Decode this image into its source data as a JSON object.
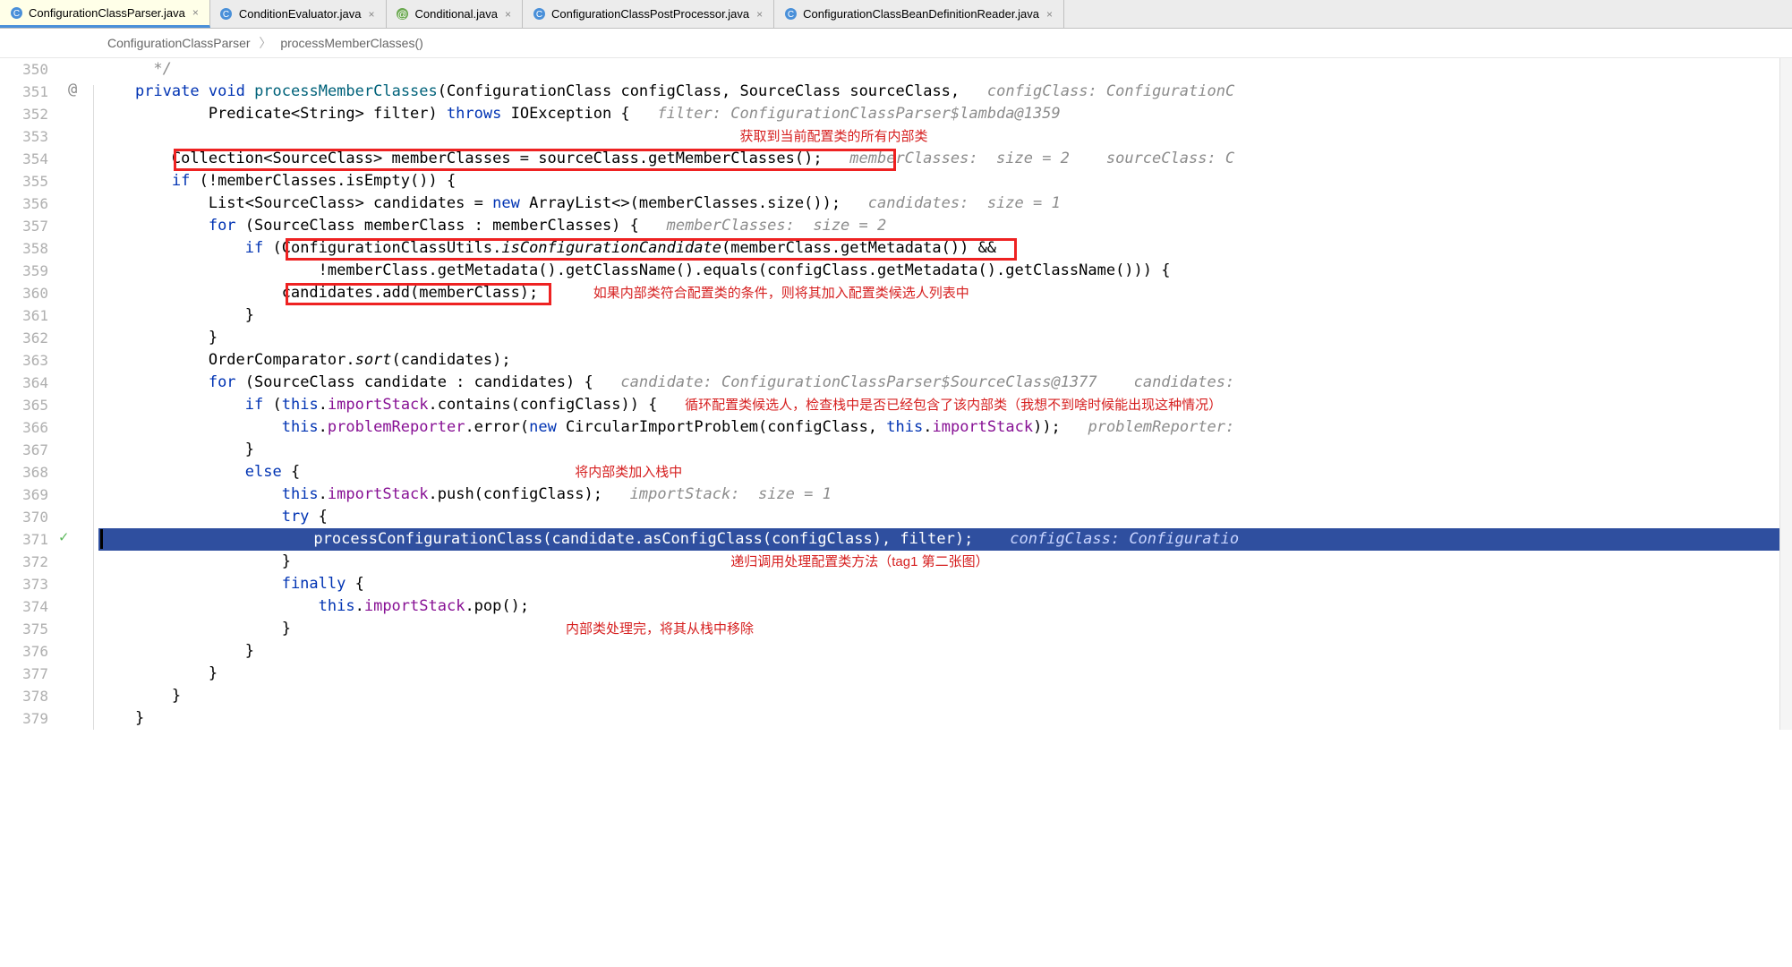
{
  "tabs": [
    {
      "label": "ConfigurationClassParser.java",
      "active": true,
      "iconColor": "blue"
    },
    {
      "label": "ConditionEvaluator.java",
      "active": false,
      "iconColor": "blue"
    },
    {
      "label": "Conditional.java",
      "active": false,
      "iconColor": "green"
    },
    {
      "label": "ConfigurationClassPostProcessor.java",
      "active": false,
      "iconColor": "blue"
    },
    {
      "label": "ConfigurationClassBeanDefinitionReader.java",
      "active": false,
      "iconColor": "blue"
    }
  ],
  "breadcrumb": {
    "class": "ConfigurationClassParser",
    "method": "processMemberClasses()"
  },
  "lineStart": 350,
  "lineEnd": 379,
  "gutterMarkers": {
    "at": 351,
    "check": 371
  },
  "annotations": {
    "a1": "获取到当前配置类的所有内部类",
    "a2": "如果内部类符合配置类的条件，则将其加入配置类候选人列表中",
    "a3": "循环配置类候选人，检查栈中是否已经包含了该内部类（我想不到啥时候能出现这种情况）",
    "a4": "将内部类加入栈中",
    "a5": "递归调用处理配置类方法（tag1 第二张图）",
    "a6": "内部类处理完，将其从栈中移除"
  },
  "hints": {
    "h351": "configClass: ConfigurationC",
    "h352": "filter: ConfigurationClassParser$lambda@1359",
    "h354a": "memberClasses:  size = 2",
    "h354b": "sourceClass: C",
    "h356": "candidates:  size = 1",
    "h357": "memberClasses:  size = 2",
    "h364a": "candidate: ConfigurationClassParser$SourceClass@1377",
    "h364b": "candidates:",
    "h366": "problemReporter:",
    "h369": "importStack:  size = 1",
    "h371": "configClass: Configuratio"
  },
  "code": {
    "l350": "*/",
    "l351_pre": "private void ",
    "l351_m": "processMemberClasses",
    "l351_post": "(ConfigurationClass configClass, SourceClass sourceClass,",
    "l352": "Predicate<String> filter) throws IOException {",
    "l354": "Collection<SourceClass> memberClasses = sourceClass.getMemberClasses();",
    "l355": "if (!memberClasses.isEmpty()) {",
    "l356": "List<SourceClass> candidates = new ArrayList<>(memberClasses.size());",
    "l357": "for (SourceClass memberClass : memberClasses) {",
    "l358": "if (ConfigurationClassUtils.isConfigurationCandidate(memberClass.getMetadata()) &&",
    "l359": "!memberClass.getMetadata().getClassName().equals(configClass.getMetadata().getClassName())) {",
    "l360": "candidates.add(memberClass);",
    "l363": "OrderComparator.sort(candidates);",
    "l364": "for (SourceClass candidate : candidates) {",
    "l365": "if (this.importStack.contains(configClass)) {",
    "l366": "this.problemReporter.error(new CircularImportProblem(configClass, this.importStack));",
    "l368": "else {",
    "l369": "this.importStack.push(configClass);",
    "l370": "try {",
    "l371": "processConfigurationClass(candidate.asConfigClass(configClass), filter);",
    "l373": "finally {",
    "l374": "this.importStack.pop();"
  }
}
